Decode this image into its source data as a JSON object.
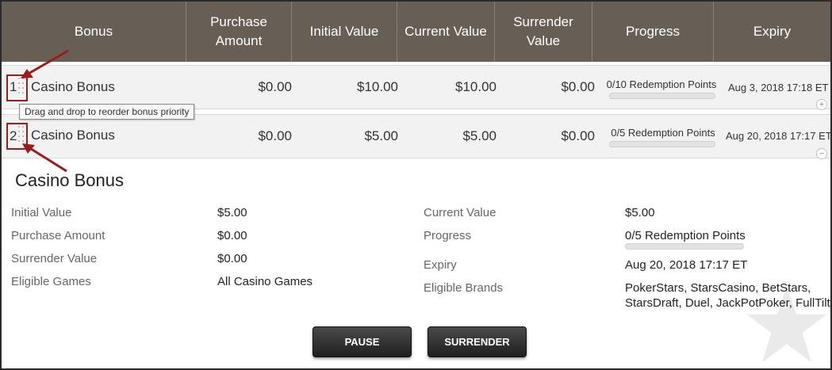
{
  "table": {
    "headers": {
      "bonus": "Bonus",
      "purchase_amount": "Purchase Amount",
      "initial_value": "Initial Value",
      "current_value": "Current Value",
      "surrender_value": "Surrender Value",
      "progress": "Progress",
      "expiry": "Expiry"
    },
    "rows": [
      {
        "index": "1",
        "name": "Casino Bonus",
        "purchase_amount": "$0.00",
        "initial_value": "$10.00",
        "current_value": "$10.00",
        "surrender_value": "$0.00",
        "progress_label": "0/10 Redemption Points",
        "progress_fraction": 0,
        "expiry": "Aug 3, 2018 17:18 ET",
        "toggle": "+"
      },
      {
        "index": "2",
        "name": "Casino Bonus",
        "purchase_amount": "$0.00",
        "initial_value": "$5.00",
        "current_value": "$5.00",
        "surrender_value": "$0.00",
        "progress_label": "0/5 Redemption Points",
        "progress_fraction": 0,
        "expiry": "Aug 20, 2018 17:17 ET",
        "toggle": "−"
      }
    ]
  },
  "tooltip": "Drag and drop to reorder bonus priority",
  "detail": {
    "title": "Casino Bonus",
    "labels": {
      "initial_value": "Initial Value",
      "purchase_amount": "Purchase Amount",
      "surrender_value": "Surrender Value",
      "eligible_games": "Eligible Games",
      "current_value": "Current Value",
      "progress": "Progress",
      "expiry": "Expiry",
      "eligible_brands": "Eligible Brands"
    },
    "values": {
      "initial_value": "$5.00",
      "purchase_amount": "$0.00",
      "surrender_value": "$0.00",
      "eligible_games": "All Casino Games",
      "current_value": "$5.00",
      "progress": "0/5 Redemption Points",
      "progress_fraction": 0,
      "expiry": "Aug 20, 2018 17:17 ET",
      "eligible_brands_line1": "PokerStars, StarsCasino, BetStars,",
      "eligible_brands_line2": "StarsDraft, Duel, JackPotPoker, FullTilt"
    }
  },
  "buttons": {
    "pause": "PAUSE",
    "surrender": "SURRENDER"
  },
  "colors": {
    "header_bg": "#675f56",
    "row_bg": "#f2f2f2",
    "annotation_red": "#9b1c1c",
    "button_dark": "#2a2a2a"
  }
}
